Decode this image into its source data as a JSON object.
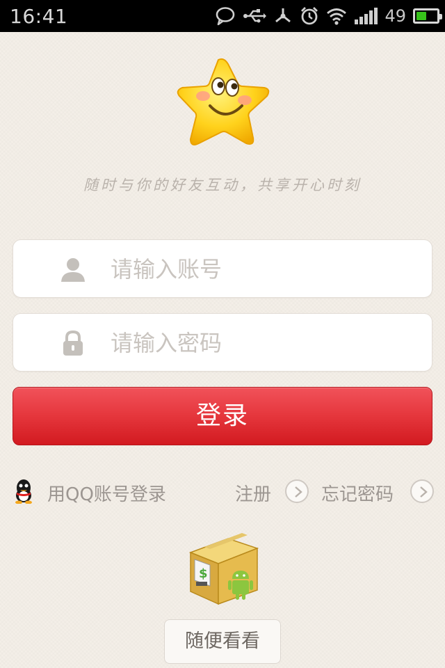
{
  "status_bar": {
    "time": "16:41",
    "battery_percent": "49",
    "battery_level": 0.49,
    "icons": [
      "chat-icon",
      "usb-icon",
      "debug-icon",
      "alarm-icon",
      "wifi-icon",
      "signal-icon",
      "battery-icon"
    ]
  },
  "tagline": "随时与你的好友互动，共享开心时刻",
  "login_form": {
    "account_placeholder": "请输入账号",
    "account_value": "",
    "password_placeholder": "请输入密码",
    "password_value": "",
    "login_label": "登录"
  },
  "links": {
    "qq_login": "用QQ账号登录",
    "register": "注册",
    "forgot_password": "忘记密码"
  },
  "browse_label": "随便看看",
  "colors": {
    "accent_red": "#e5363c",
    "background": "#f4efe8",
    "status_bar": "#000000",
    "battery_green": "#36c21a"
  }
}
